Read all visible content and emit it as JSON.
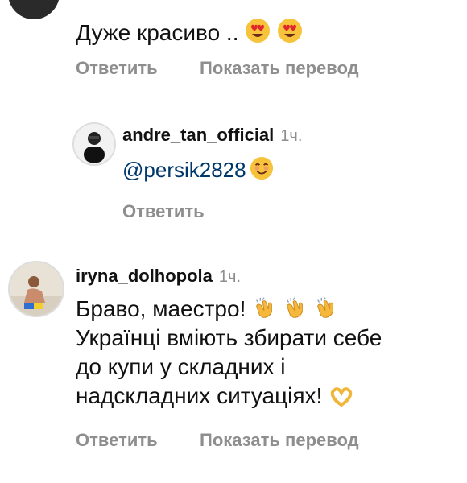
{
  "comments": [
    {
      "text": "Дуже красиво ..",
      "reply_label": "Ответить",
      "translate_label": "Показать перевод"
    },
    {
      "username": "andre_tan_official",
      "time": "1ч.",
      "mention": "@persik2828",
      "reply_label": "Ответить"
    },
    {
      "username": "iryna_dolhopola",
      "time": "1ч.",
      "lines": [
        "Браво, маестро!",
        "Українці вміють збирати себе",
        "до купи у складних і",
        "надскладних ситуаціях!"
      ],
      "reply_label": "Ответить",
      "translate_label": "Показать перевод"
    }
  ],
  "icons": {
    "heart_eyes": "heart-eyes-emoji",
    "smile": "smiling-emoji",
    "clap": "clapping-hands-emoji",
    "heart_hands": "heart-hands-emoji"
  }
}
